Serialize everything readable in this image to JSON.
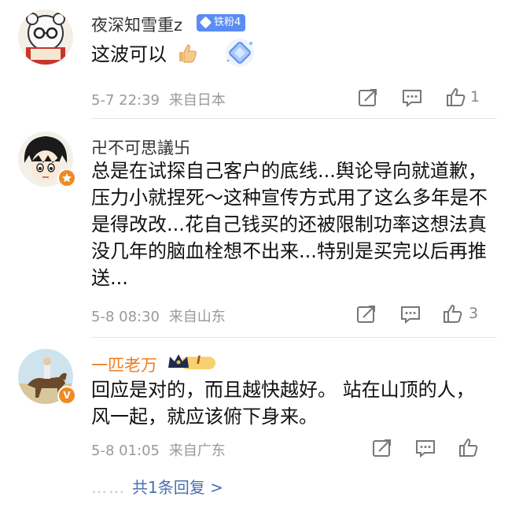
{
  "comments": [
    {
      "username": "夜深知雪重z",
      "fan_badge": "铁粉4",
      "text": "这波可以",
      "timestamp": "5-7 22:39",
      "location": "来自日本",
      "likes": "1"
    },
    {
      "username": "卍不可思議卐",
      "text": "总是在试探自己客户的底线...舆论导向就道歉，压力小就捏死～这种宣传方式用了这么多年是不是得改改...花自己钱买的还被限制功率这想法真没几年的脑血栓想不出来...特别是买完以后再推送...",
      "timestamp": "5-8 08:30",
      "location": "来自山东",
      "likes": "3"
    },
    {
      "username": "一匹老万",
      "vip_level": "I",
      "text": "回应是对的，而且越快越好。 站在山顶的人，风一起，就应该俯下身来。",
      "timestamp": "5-8 01:05",
      "location": "来自广东"
    }
  ],
  "reply_summary": "共1条回复 >",
  "icons": {
    "share": "share-icon",
    "comment": "comment-icon",
    "like": "thumbs-up-icon",
    "verified": "verified-v-icon"
  },
  "colors": {
    "fan_badge": "#5b8cf5",
    "vip_name": "#f07c1e",
    "verified_badge": "#f08a24",
    "reply_link": "#4a6fb0"
  }
}
